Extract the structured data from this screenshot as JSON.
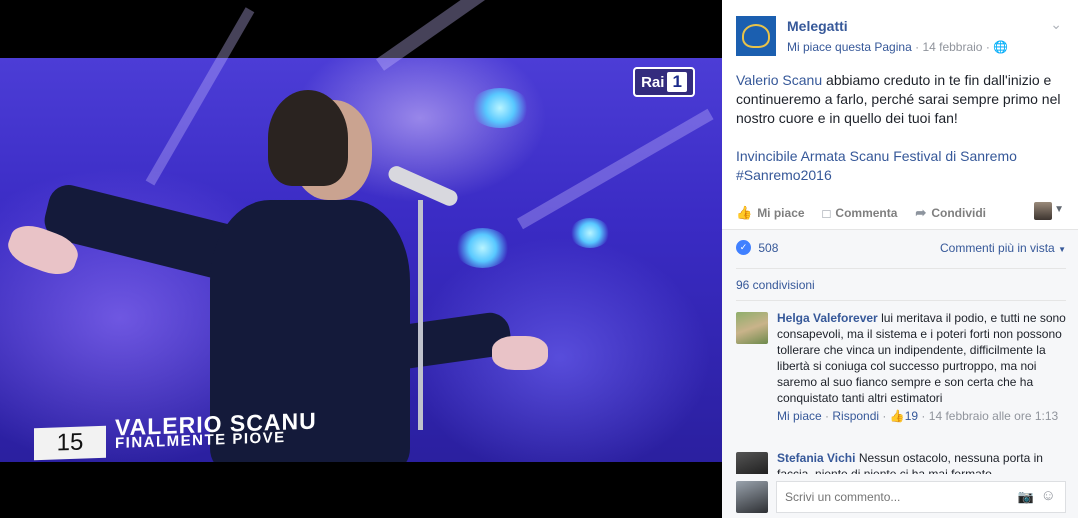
{
  "photo": {
    "channel_logo": {
      "text": "Rai",
      "number": "1"
    },
    "caption": {
      "number": "15",
      "first_name": "VALERIO",
      "last_name": "SCANU",
      "song": "FINALMENTE PIOVE"
    }
  },
  "post": {
    "page_name": "Melegatti",
    "like_page": "Mi piace questa Pagina",
    "date": "14 febbraio",
    "text_link": "Valerio Scanu",
    "text_body": " abbiamo creduto in te fin dall'inizio e continueremo a farlo, perché sarai sempre primo nel nostro cuore e in quello dei tuoi fan!",
    "hashtags": "Invincibile Armata Scanu Festival di Sanremo #Sanremo2016",
    "icons": {
      "logo": "melegatti-crest-icon",
      "globe": "globe-icon",
      "menu": "chevron-down-icon"
    }
  },
  "actions": {
    "like": "Mi piace",
    "comment": "Commenta",
    "share": "Condividi"
  },
  "engagement": {
    "likes_count": "508",
    "sort_label": "Commenti più in vista",
    "shares": "96 condivisioni"
  },
  "comments": [
    {
      "author": "Helga Valeforever",
      "text": "lui meritava il podio, e tutti ne sono consapevoli, ma il sistema e i poteri forti non possono tollerare che vinca un indipendente, difficilmente la libertà si coniuga col successo purtroppo, ma noi saremo al suo fianco sempre e son certa che ha conquistato tanti altri estimatori",
      "like_label": "Mi piace",
      "reply_label": "Rispondi",
      "reactions": "19",
      "timestamp": "14 febbraio alle ore 1:13"
    },
    {
      "author": "Stefania Vichi",
      "text": "Nessun ostacolo, nessuna porta in faccia, niente di niente ci ha mai fermato..."
    }
  ],
  "composer": {
    "placeholder": "Scrivi un commento..."
  },
  "colors": {
    "link": "#365899",
    "brand": "#1b5fb0",
    "stage": "#3a2bc4"
  }
}
